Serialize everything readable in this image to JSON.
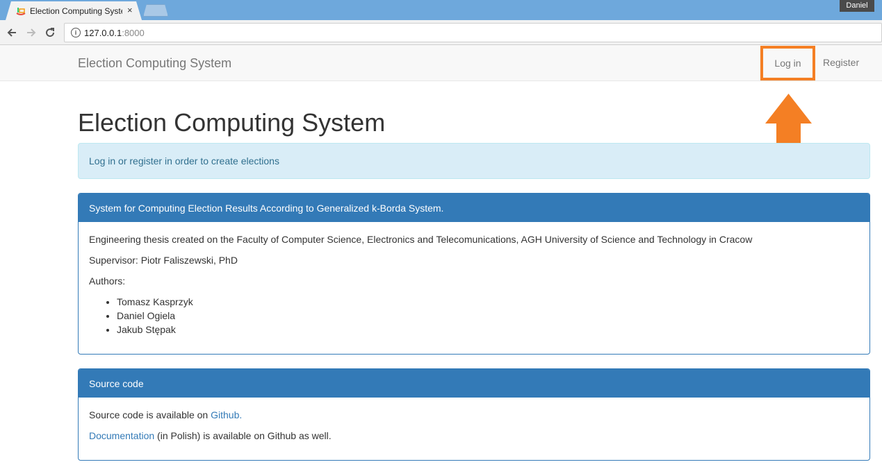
{
  "browser": {
    "tab_title": "Election Computing System",
    "tab_close": "×",
    "profile_name": "Daniel",
    "url_host": "127.0.0.1",
    "url_port": ":8000"
  },
  "navbar": {
    "brand": "Election Computing System",
    "login": "Log in",
    "register": "Register"
  },
  "highlight_color": "#f47f24",
  "page_title": "Election Computing System",
  "alert": {
    "login_link": "Log in",
    "or": " or ",
    "register_link": "register",
    "rest": " in order to create elections"
  },
  "panel_about": {
    "heading": "System for Computing Election Results According to Generalized k-Borda System.",
    "thesis": "Engineering thesis created on the Faculty of Computer Science, Electronics and Telecomunications, AGH University of Science and Technology in Cracow",
    "supervisor": "Supervisor: Piotr Faliszewski, PhD",
    "authors_label": "Authors:",
    "authors": [
      "Tomasz Kasprzyk",
      "Daniel Ogiela",
      "Jakub Stępak"
    ]
  },
  "panel_source": {
    "heading": "Source code",
    "line1_prefix": "Source code is available on ",
    "line1_link": "Github",
    "line1_suffix": ".",
    "line2_link": "Documentation",
    "line2_suffix": " (in Polish) is available on Github as well."
  }
}
